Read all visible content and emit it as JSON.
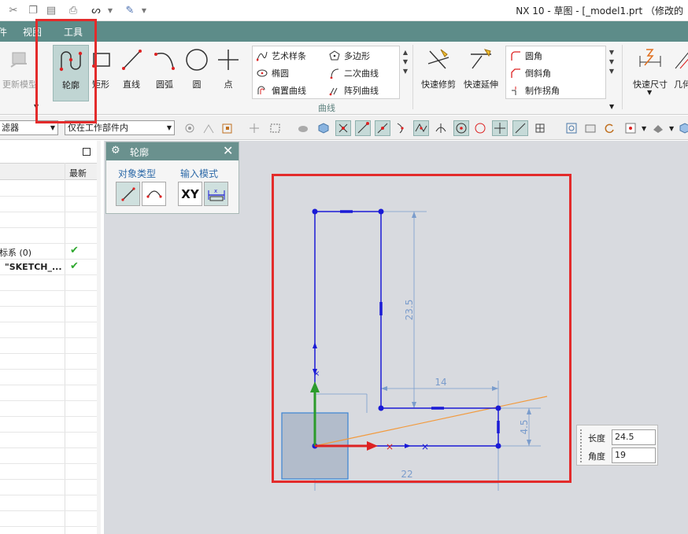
{
  "window": {
    "title": "NX 10 - 草图 - [_model1.prt （修改的"
  },
  "menu": {
    "items": [
      "件",
      "视图",
      "工具"
    ]
  },
  "ribbon": {
    "buttons": [
      {
        "name": "update-model-button",
        "label": "更新模型",
        "enabled": false
      },
      {
        "name": "profile-button",
        "label": "轮廓",
        "active": true
      },
      {
        "name": "rectangle-button",
        "label": "矩形"
      },
      {
        "name": "line-button",
        "label": "直线"
      },
      {
        "name": "arc-button",
        "label": "圆弧"
      },
      {
        "name": "circle-button",
        "label": "圆"
      },
      {
        "name": "point-button",
        "label": "点"
      }
    ],
    "curve_group_col1": [
      "艺术样条",
      "椭圆",
      "偏置曲线"
    ],
    "curve_group_col2": [
      "多边形",
      "二次曲线",
      "阵列曲线"
    ],
    "curve_group_label": "曲线",
    "trim_buttons": [
      {
        "name": "quick-trim-button",
        "label": "快速修剪"
      },
      {
        "name": "quick-extend-button",
        "label": "快速延伸"
      }
    ],
    "corner_group": [
      "圆角",
      "倒斜角",
      "制作拐角"
    ],
    "dim_buttons": [
      {
        "name": "rapid-dimension-button",
        "label": "快速尺寸"
      },
      {
        "name": "geometric-constraint-button",
        "label": "几何"
      }
    ]
  },
  "toolbar": {
    "filter_label": "滤器",
    "scope_value": "仅在工作部件内"
  },
  "navigator": {
    "column_latest": "最新",
    "rows": [
      {
        "label": "标系 (0)",
        "check": "✔"
      },
      {
        "label": "\"SKETCH_...",
        "check": "✔"
      }
    ]
  },
  "dialog": {
    "title": "轮廓",
    "object_type_label": "对象类型",
    "input_mode_label": "输入模式",
    "xy_label": "XY"
  },
  "dimensions": {
    "vertical_main": "23.5",
    "horizontal_step": "14",
    "vertical_step": "4.5",
    "horizontal_base": "22"
  },
  "value_input": {
    "length_label": "长度",
    "length_value": "24.5",
    "angle_label": "角度",
    "angle_value": "19"
  },
  "colors": {
    "menubar": "#5d8c89",
    "sketch_line": "#1a1ad6",
    "dimension": "#7a9ccc",
    "rubber_band": "#f29a3d",
    "highlight_box": "#e32b2b",
    "check": "#2fa82f"
  }
}
